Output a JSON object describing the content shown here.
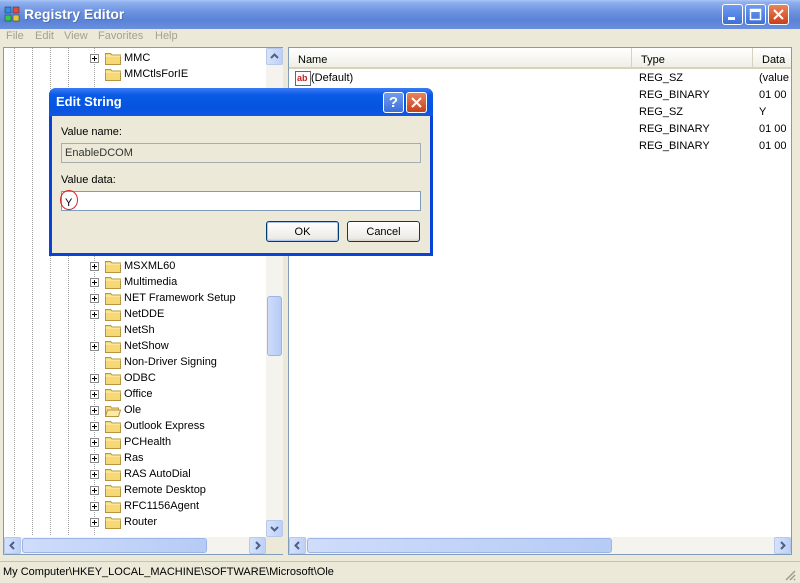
{
  "window": {
    "title": "Registry Editor"
  },
  "menu": [
    "File",
    "Edit",
    "View",
    "Favorites",
    "Help"
  ],
  "tree": {
    "items": [
      {
        "label": "MMC",
        "expandable": true
      },
      {
        "label": "MMCtlsForIE",
        "expandable": false
      },
      {
        "label": "MSXML60",
        "expandable": true
      },
      {
        "label": "Multimedia",
        "expandable": true
      },
      {
        "label": "NET Framework Setup",
        "expandable": true
      },
      {
        "label": "NetDDE",
        "expandable": true
      },
      {
        "label": "NetSh",
        "expandable": false
      },
      {
        "label": "NetShow",
        "expandable": true
      },
      {
        "label": "Non-Driver Signing",
        "expandable": false
      },
      {
        "label": "ODBC",
        "expandable": true
      },
      {
        "label": "Office",
        "expandable": true
      },
      {
        "label": "Ole",
        "expandable": true,
        "open": true
      },
      {
        "label": "Outlook Express",
        "expandable": true
      },
      {
        "label": "PCHealth",
        "expandable": true
      },
      {
        "label": "Ras",
        "expandable": true
      },
      {
        "label": "RAS AutoDial",
        "expandable": true
      },
      {
        "label": "Remote Desktop",
        "expandable": true
      },
      {
        "label": "RFC1156Agent",
        "expandable": true
      },
      {
        "label": "Router",
        "expandable": true
      }
    ]
  },
  "list": {
    "columns": {
      "name": "Name",
      "type": "Type",
      "data": "Data"
    },
    "rows": [
      {
        "name": "(Default)",
        "type": "REG_SZ",
        "data": "(value"
      },
      {
        "name": "",
        "type": "REG_BINARY",
        "data": "01 00"
      },
      {
        "name": "",
        "type": "REG_SZ",
        "data": "Y"
      },
      {
        "name": "",
        "type": "REG_BINARY",
        "data": "01 00"
      },
      {
        "name": "",
        "type": "REG_BINARY",
        "data": "01 00"
      }
    ]
  },
  "dialog": {
    "title": "Edit String",
    "help_label": "?",
    "value_name_label": "Value name:",
    "value_name": "EnableDCOM",
    "value_data_label": "Value data:",
    "value_data": "Y",
    "ok_label": "OK",
    "cancel_label": "Cancel"
  },
  "status": {
    "path": "My Computer\\HKEY_LOCAL_MACHINE\\SOFTWARE\\Microsoft\\Ole"
  },
  "colors": {
    "titlebar": "#0a5ae6",
    "face": "#ece9d8",
    "annotation": "#dd2222"
  }
}
